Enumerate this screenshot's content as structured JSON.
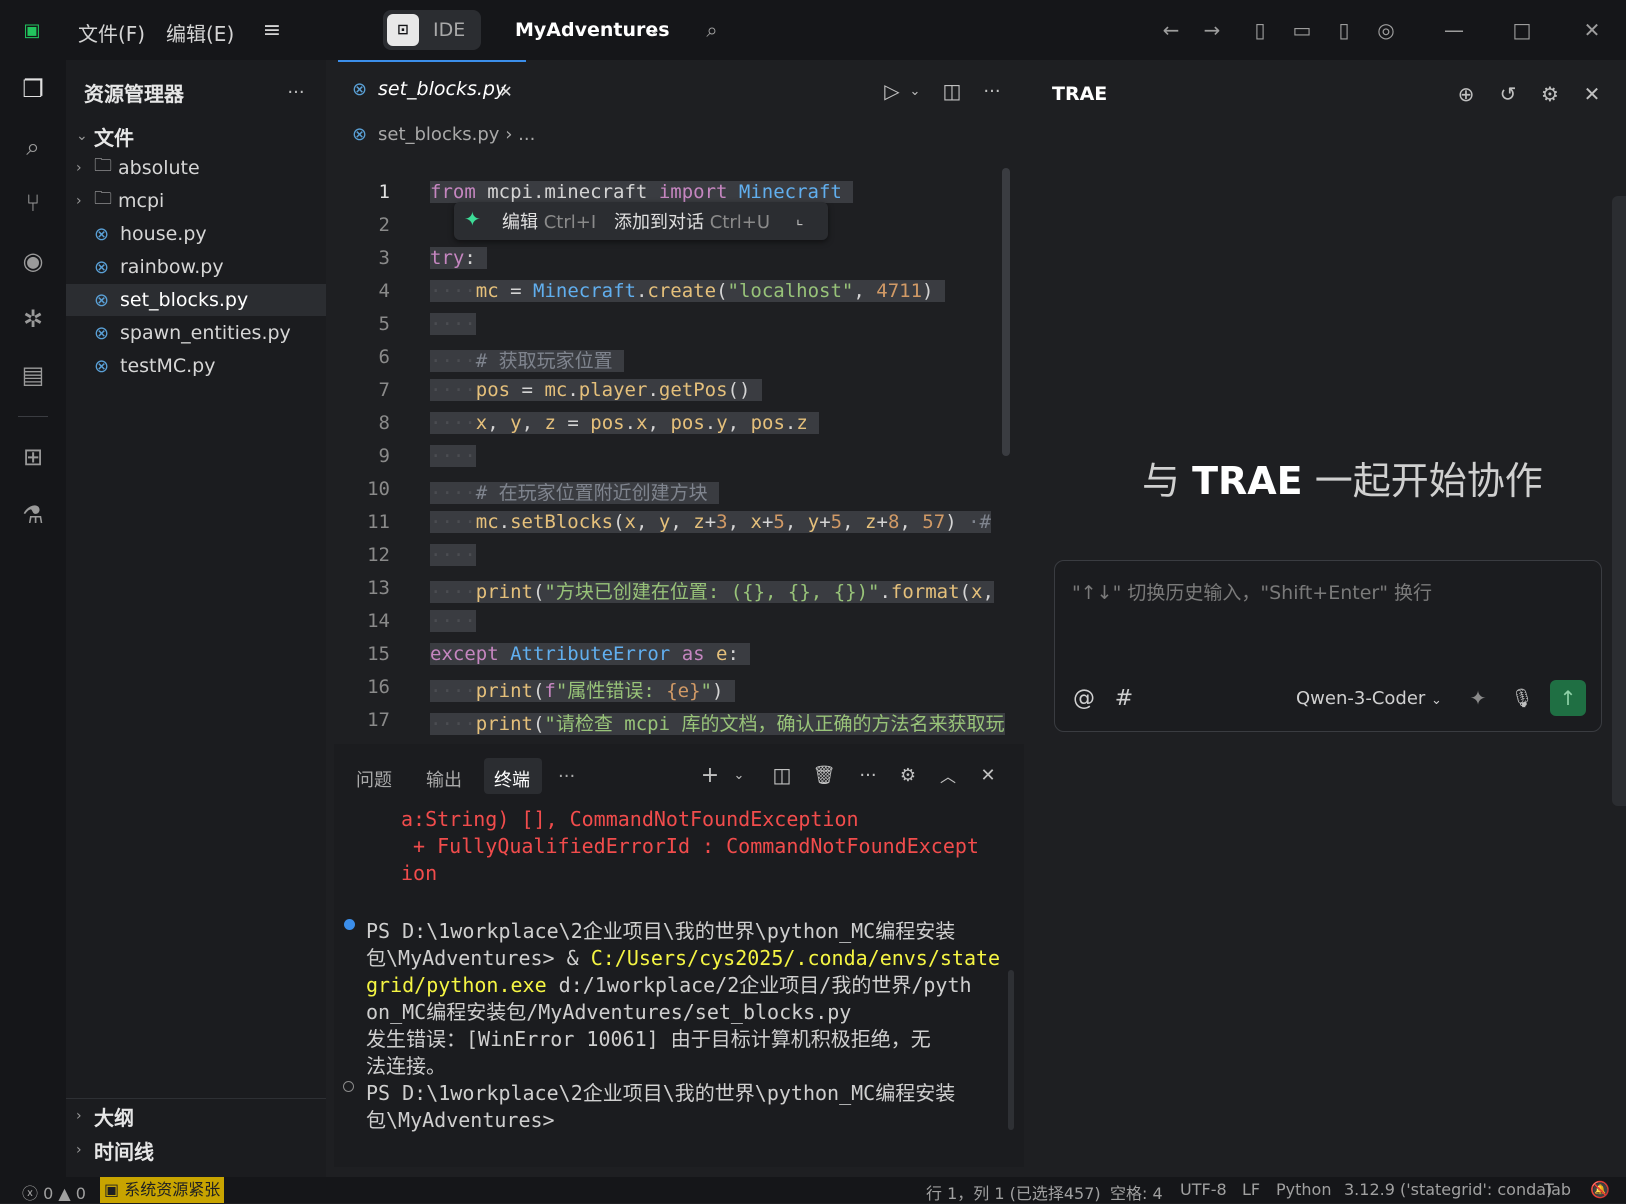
{
  "menu": {
    "file": "文件(F)",
    "edit": "编辑(E)"
  },
  "titlebar": {
    "ide_label": "IDE",
    "project": "MyAdventures"
  },
  "explorer": {
    "title": "资源管理器",
    "root": "文件",
    "items": [
      {
        "name": "absolute",
        "type": "folder"
      },
      {
        "name": "mcpi",
        "type": "folder"
      },
      {
        "name": "house.py",
        "type": "file"
      },
      {
        "name": "rainbow.py",
        "type": "file"
      },
      {
        "name": "set_blocks.py",
        "type": "file"
      },
      {
        "name": "spawn_entities.py",
        "type": "file"
      },
      {
        "name": "testMC.py",
        "type": "file"
      }
    ],
    "outline": "大纲",
    "timeline": "时间线"
  },
  "editor": {
    "tab": "set_blocks.py",
    "breadcrumb_file": "set_blocks.py",
    "breadcrumb_more": "...",
    "popup_edit": "编辑",
    "popup_edit_key": "Ctrl+I",
    "popup_add": "添加到对话",
    "popup_add_key": "Ctrl+U",
    "line_numbers": [
      "1",
      "2",
      "3",
      "4",
      "5",
      "6",
      "7",
      "8",
      "9",
      "10",
      "11",
      "12",
      "13",
      "14",
      "15",
      "16",
      "17"
    ]
  },
  "panel": {
    "tab_problems": "问题",
    "tab_output": "输出",
    "tab_terminal": "终端",
    "tab_more": "···",
    "lines": [
      {
        "text": "a:String) [], CommandNotFoundException",
        "cls": "err"
      },
      {
        "text": " + FullyQualifiedErrorId : CommandNotFoundExcept",
        "cls": "err"
      },
      {
        "text": "ion",
        "cls": "err"
      }
    ],
    "cmd_prompt": "PS D:\\1workplace\\2企业项目\\我的世界\\python_MC编程安装",
    "cmd_prompt2": "包\\MyAdventures> & ",
    "cmd_exe1": "C:/Users/cys2025/.conda/envs/state",
    "cmd_exe2": "grid/python.exe",
    "cmd_arg1": " d:/1workplace/2企业项目/我的世界/pyth",
    "cmd_arg2": "on_MC编程安装包/MyAdventures/set_blocks.py",
    "cmd_out1": "发生错误：[WinError 10061] 由于目标计算机积极拒绝，无",
    "cmd_out2": "法连接。",
    "prompt2_1": "PS D:\\1workplace\\2企业项目\\我的世界\\python_MC编程安装",
    "prompt2_2": "包\\MyAdventures>"
  },
  "trae": {
    "title": "TRAE",
    "welcome_pre": "与 ",
    "welcome_brand": "TRAE",
    "welcome_post": " 一起开始协作",
    "placeholder": "\"↑↓\" 切换历史输入，\"Shift+Enter\" 换行",
    "model": "Qwen-3-Coder"
  },
  "status": {
    "errors": "0",
    "warnings": "0",
    "resource": "系统资源紧张",
    "position": "行 1，列 1 (已选择457)",
    "spaces": "空格: 4",
    "encoding": "UTF-8",
    "eol": "LF",
    "language": "Python",
    "interpreter": "3.12.9 ('stategrid': conda)",
    "indent": "Tab"
  },
  "colors": {
    "accent": "#3b8eea",
    "send": "#1f6f43",
    "warning_bg": "#c8a400"
  }
}
